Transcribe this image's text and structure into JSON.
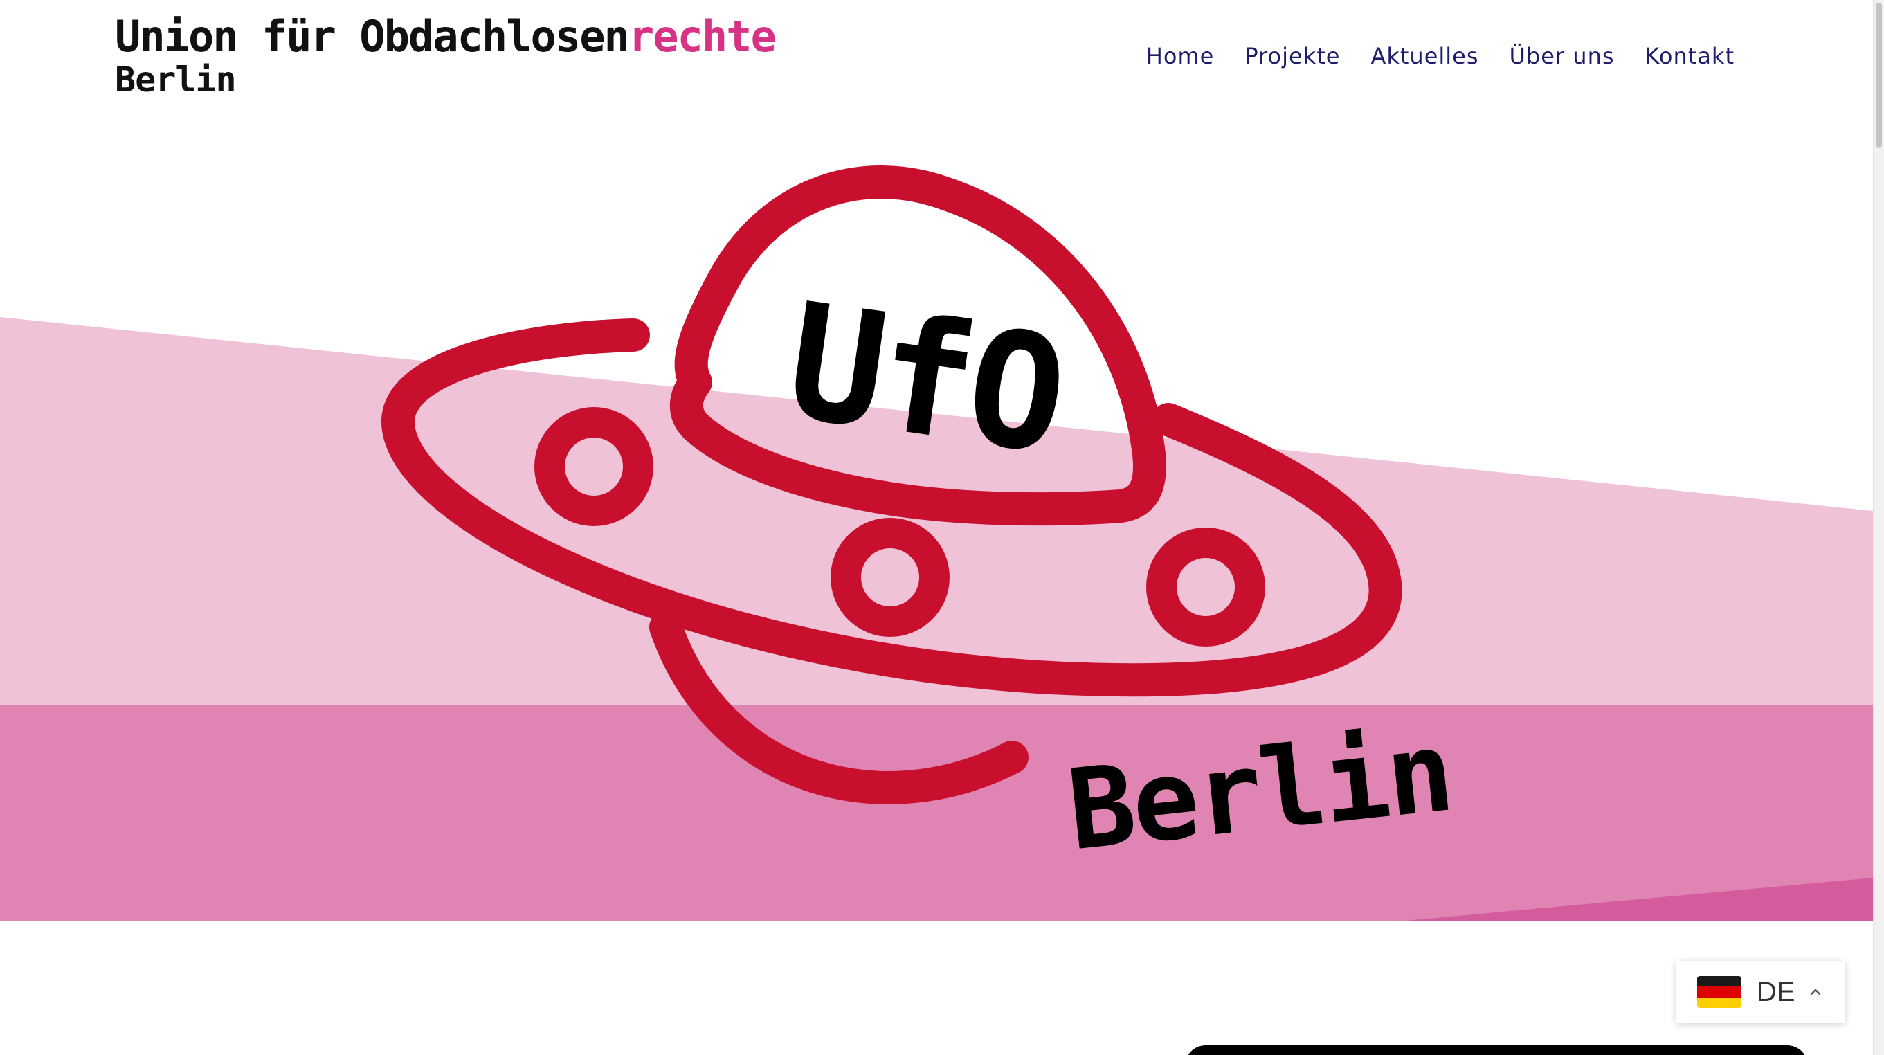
{
  "header": {
    "logo": {
      "line1_main": "Union für Obdachlosen",
      "line1_accent": "rechte",
      "line2": "Berlin"
    },
    "nav": [
      {
        "label": "Home"
      },
      {
        "label": "Projekte"
      },
      {
        "label": "Aktuelles"
      },
      {
        "label": "Über uns"
      },
      {
        "label": "Kontakt"
      }
    ]
  },
  "hero": {
    "logo_title": "UfO",
    "logo_subtitle": "Berlin",
    "colors": {
      "light_pink": "#f0c2d8",
      "mid_pink": "#e084b3",
      "dark_pink": "#d45c9c",
      "ufo_red": "#c8102e"
    }
  },
  "language_switcher": {
    "code": "DE",
    "flag_icon": "germany-flag-icon",
    "caret_icon": "chevron-up-icon"
  }
}
